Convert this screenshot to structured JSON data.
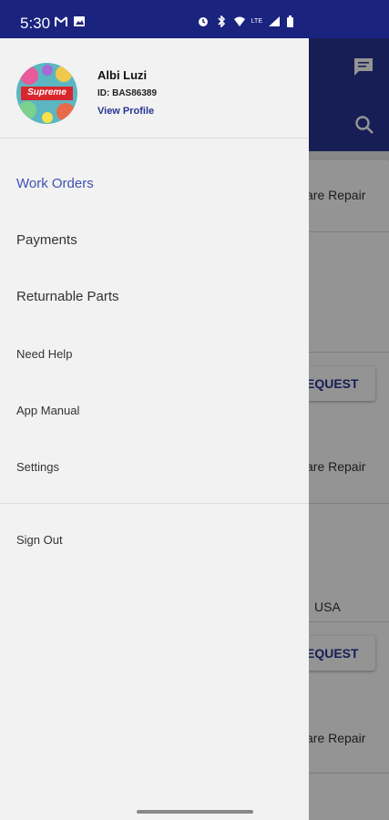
{
  "status_bar": {
    "time": "5:30",
    "left_icons": [
      "gmail-icon",
      "gallery-icon"
    ],
    "right_icons": [
      "alarm-icon",
      "bluetooth-icon",
      "wifi-icon",
      "signal-icon",
      "battery-icon"
    ],
    "lte_label": "LTE"
  },
  "profile": {
    "name": "Albi Luzi",
    "id": "ID: BAS86389",
    "view_profile": "View Profile",
    "avatar_text": "Supreme"
  },
  "menu": {
    "items": [
      {
        "label": "Work Orders",
        "active": true
      },
      {
        "label": "Payments"
      },
      {
        "label": "Returnable Parts"
      },
      {
        "label": "Need Help"
      },
      {
        "label": "App Manual"
      },
      {
        "label": "Settings"
      }
    ],
    "sign_out": "Sign Out"
  },
  "background": {
    "card_texts": [
      "are Repair",
      "are Repair",
      "USA",
      "are Repair"
    ],
    "request_label": "EQUEST",
    "header_icons": [
      "chat-icon",
      "search-icon"
    ]
  },
  "colors": {
    "header": "#283593",
    "status_bar": "#1a237e",
    "accent": "#3f51b5"
  }
}
